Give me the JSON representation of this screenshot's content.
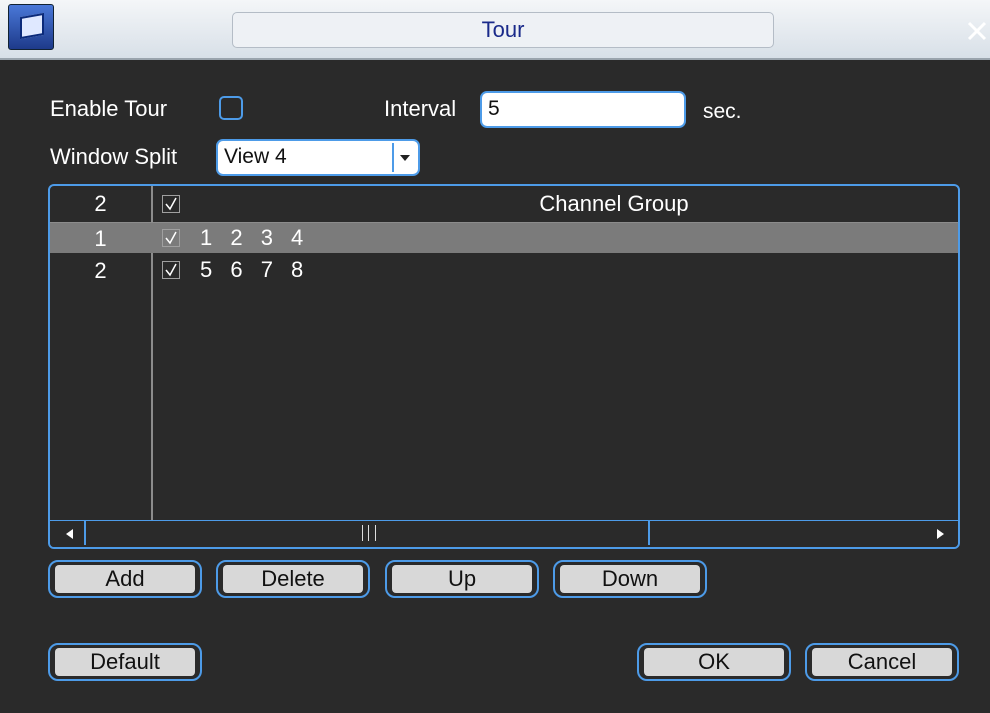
{
  "window": {
    "title": "Tour"
  },
  "form": {
    "enable_tour_label": "Enable Tour",
    "interval_label": "Interval",
    "interval_value": "5",
    "interval_unit": "sec.",
    "window_split_label": "Window Split",
    "window_split_value": "View 4"
  },
  "table": {
    "header": {
      "count": "2",
      "title": "Channel Group"
    },
    "rows": [
      {
        "num": "1",
        "channels": "1 2 3 4",
        "checked": true,
        "selected": true
      },
      {
        "num": "2",
        "channels": "5 6 7 8",
        "checked": true,
        "selected": false
      }
    ]
  },
  "buttons": {
    "add": "Add",
    "delete": "Delete",
    "up": "Up",
    "down": "Down",
    "default": "Default",
    "ok": "OK",
    "cancel": "Cancel"
  },
  "colors": {
    "accent": "#4d9be8",
    "background": "#2a2a2a",
    "selected_row": "#7b7b7b",
    "title_text": "#1a2a8a"
  }
}
